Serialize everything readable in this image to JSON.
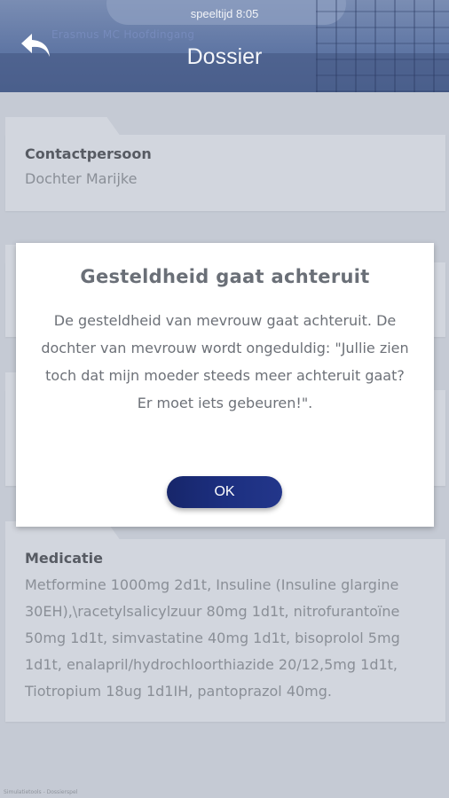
{
  "header": {
    "time_label": "speeltijd  8:05",
    "title": "Dossier",
    "background_signage": "Erasmus MC  Hoofdingang",
    "back_icon": "back-arrow-icon"
  },
  "cards": {
    "contact": {
      "label": "Contactpersoon",
      "value": "Dochter Marijke"
    },
    "medication": {
      "label": "Medicatie",
      "lines": [
        "Metformine 1000mg 2d1t, Insuline (Insuline glargine",
        "30EH),\\racetylsalicylzuur 80mg 1d1t, nitrofurantoïne",
        "50mg 1d1t, simvastatine 40mg 1d1t, bisoprolol 5mg",
        "1d1t, enalapril/hydrochloorthiazide 20/12,5mg 1d1t,",
        "Tiotropium 18ug 1d1IH, pantoprazol 40mg."
      ]
    }
  },
  "dialog": {
    "title": "Gesteldheid gaat achteruit",
    "message_lines": [
      "De gesteldheid van mevrouw gaat achteruit. De",
      "dochter van mevrouw wordt ongeduldig:  \"Jullie zien",
      "toch dat mijn moeder steeds meer achteruit gaat?",
      "Er moet iets gebeuren!\"."
    ],
    "ok_label": "OK"
  },
  "footer": {
    "note": "Simulatietools - Dossierspel"
  },
  "colors": {
    "accent": "#1c2f80",
    "header": "#5f76a4",
    "overlay": "#c5cad4"
  }
}
